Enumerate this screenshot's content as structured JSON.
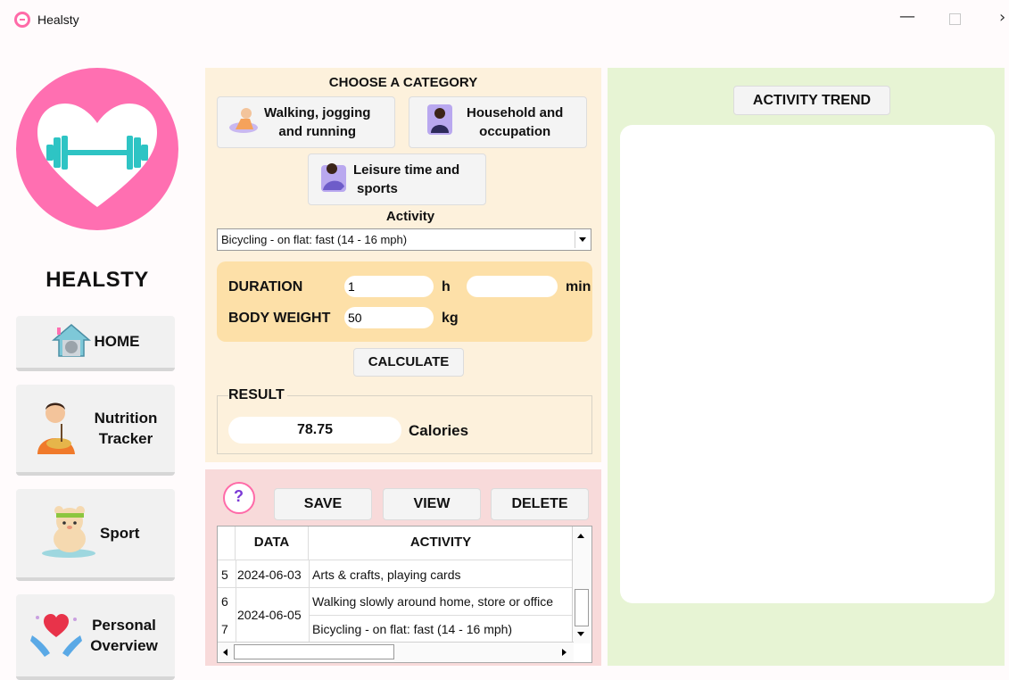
{
  "window": {
    "title": "Healsty"
  },
  "sidebar": {
    "brand": "HEALSTY",
    "nav": [
      {
        "label": "HOME",
        "icon": "house-cat-icon"
      },
      {
        "label": "Nutrition Tracker",
        "icon": "person-eating-icon"
      },
      {
        "label": "Sport",
        "icon": "bear-sport-icon"
      },
      {
        "label": "Personal Overview",
        "icon": "heart-hands-icon"
      }
    ]
  },
  "calculator": {
    "category_title": "CHOOSE A CATEGORY",
    "categories": [
      {
        "label_line1": "Walking, jogging",
        "label_line2": "and running",
        "icon": "walking-icon"
      },
      {
        "label_line1": "Household and",
        "label_line2": "occupation",
        "icon": "household-icon"
      },
      {
        "label_line1": "Leisure time and",
        "label_line2": "sports",
        "icon": "leisure-icon"
      }
    ],
    "activity_label": "Activity",
    "activity_selected": "Bicycling - on flat: fast (14 - 16 mph)",
    "duration_label": "DURATION",
    "duration_hours": "1",
    "hours_unit": "h",
    "duration_minutes": "",
    "minutes_unit": "min",
    "weight_label": "BODY WEIGHT",
    "weight_value": "50",
    "weight_unit": "kg",
    "calculate_label": "CALCULATE",
    "result_title": "RESULT",
    "result_value": "78.75",
    "result_unit": "Calories"
  },
  "log": {
    "save_label": "SAVE",
    "view_label": "VIEW",
    "delete_label": "DELETE",
    "columns": [
      "DATA",
      "ACTIVITY"
    ],
    "rows": [
      {
        "num": "5",
        "date": "2024-06-03",
        "activity": "Arts & crafts, playing cards"
      },
      {
        "num": "6",
        "date": "2024-06-05",
        "activity": "Walking slowly around home, store or office"
      },
      {
        "num": "7",
        "date": "",
        "activity": "Bicycling - on flat: fast (14 - 16 mph)"
      }
    ]
  },
  "trend": {
    "title": "ACTIVITY TREND"
  },
  "colors": {
    "brand_pink": "#ff6fb1",
    "dumbbell_teal": "#2ec4c4",
    "calc_bg": "#fdf1dc",
    "input_bg": "#fde0a8",
    "log_bg": "#f8dada",
    "trend_bg": "#e7f4d4"
  }
}
